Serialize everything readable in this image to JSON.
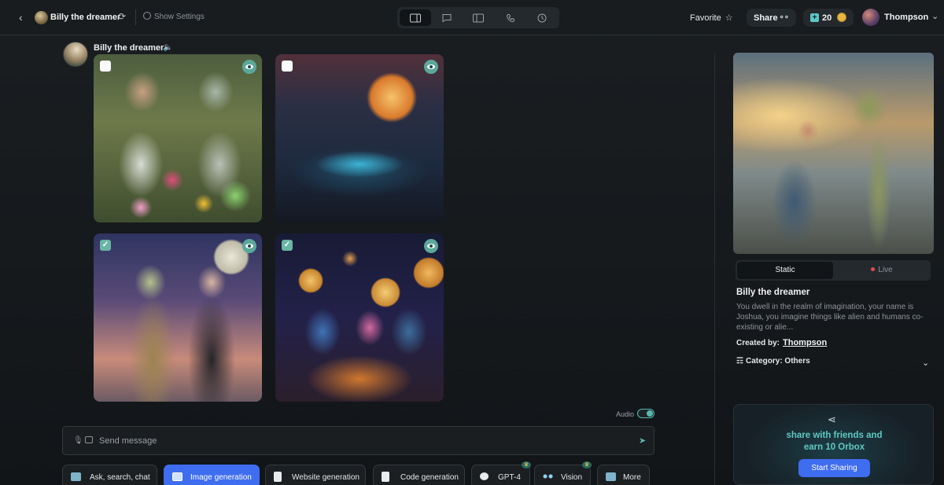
{
  "topbar": {
    "bot_name": "Billy the dreamer",
    "show_settings": "Show Settings",
    "favorite": "Favorite",
    "share": "Share",
    "credits": "20",
    "user_name": "Thompson"
  },
  "chat": {
    "bot_name": "Billy the dreamer",
    "images": [
      {
        "checked": false
      },
      {
        "checked": false
      },
      {
        "checked": true
      },
      {
        "checked": true
      }
    ],
    "audio_label": "Audio",
    "message_placeholder": "Send message"
  },
  "chips": [
    {
      "label": "Ask, search, chat"
    },
    {
      "label": "Image generation",
      "active": true
    },
    {
      "label": "Website generation"
    },
    {
      "label": "Code generation"
    },
    {
      "label": "GPT-4"
    },
    {
      "label": "Vision"
    },
    {
      "label": "More"
    }
  ],
  "panel": {
    "tab_static": "Static",
    "tab_live": "Live",
    "name": "Billy the dreamer",
    "description": "You dwell in the realm of imagination, your name is Joshua, you imagine things like alien and humans co-existing or alie...",
    "created_by_label": "Created by:",
    "creator": "Thompson",
    "category": "Category: Others",
    "share_text_1": "share with friends and",
    "share_text_2": "earn 10 Orbox",
    "share_button": "Start Sharing"
  },
  "colors": {
    "accent_blue": "#3f6df0",
    "accent_teal": "#5fc9c2",
    "background": "#16191c"
  }
}
